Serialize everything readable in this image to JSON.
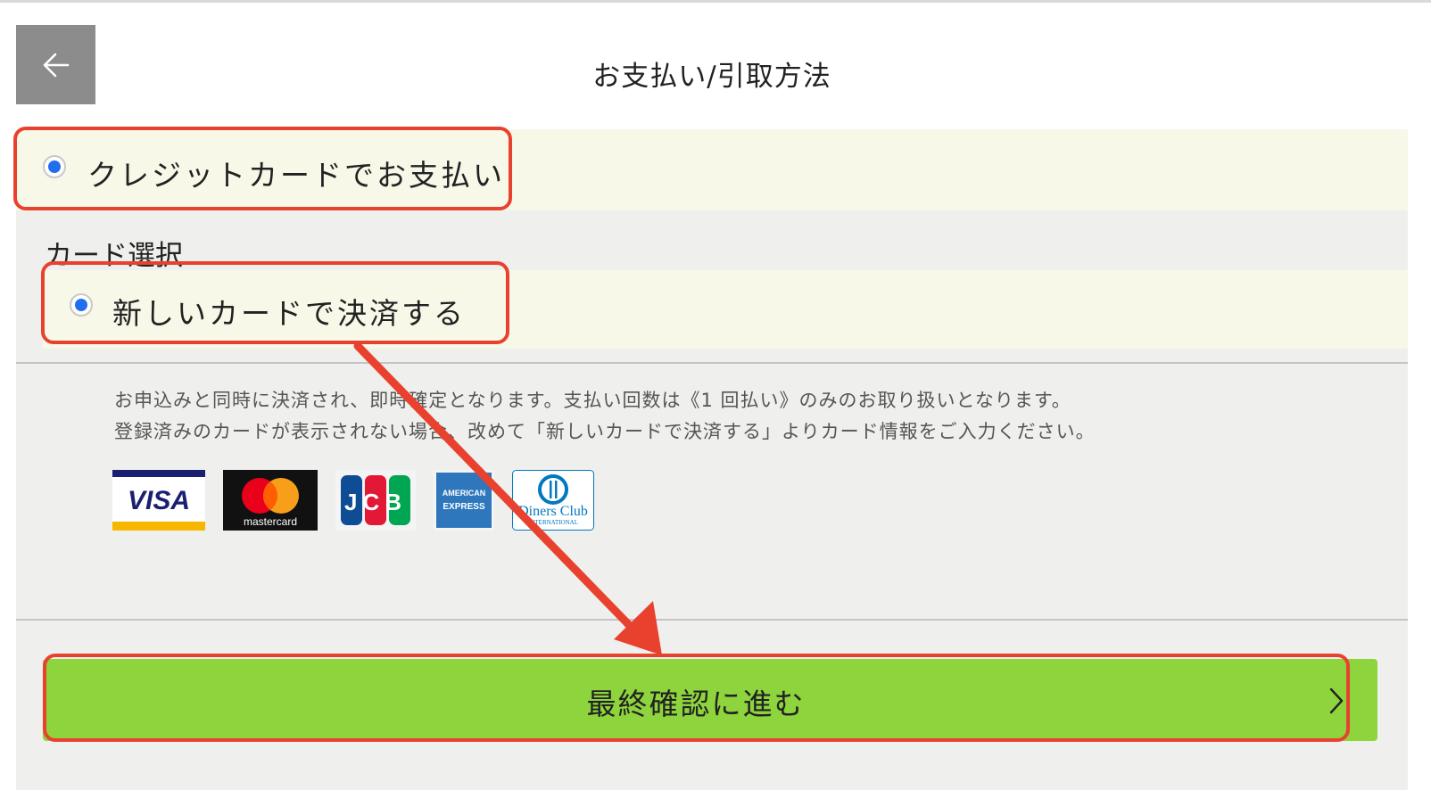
{
  "header": {
    "title": "お支払い/引取方法",
    "back_icon": "arrow-left-icon"
  },
  "payment": {
    "credit_label": "クレジットカードでお支払い",
    "credit_selected": true
  },
  "card_select": {
    "heading": "カード選択",
    "new_card_label": "新しいカードで決済する",
    "new_card_selected": true
  },
  "notes": {
    "line1": "お申込みと同時に決済され、即時確定となります。支払い回数は《1 回払い》のみのお取り扱いとなります。",
    "line2": "登録済みのカードが表示されない場合、改めて「新しいカードで決済する」よりカード情報をご入力ください。"
  },
  "card_brands": {
    "visa": "VISA",
    "mastercard": "mastercard",
    "jcb": "JCB",
    "amex_top": "AMERICAN",
    "amex_bottom": "EXPRESS",
    "diners": "Diners Club",
    "diners_sub": "INTERNATIONAL"
  },
  "cta": {
    "label": "最終確認に進む",
    "icon": "chevron-right-icon"
  },
  "colors": {
    "accent_green": "#8ed43d",
    "highlight_row": "#f7f8e8",
    "radio_blue": "#1f6ff0",
    "annotation_red": "#e8422f"
  }
}
